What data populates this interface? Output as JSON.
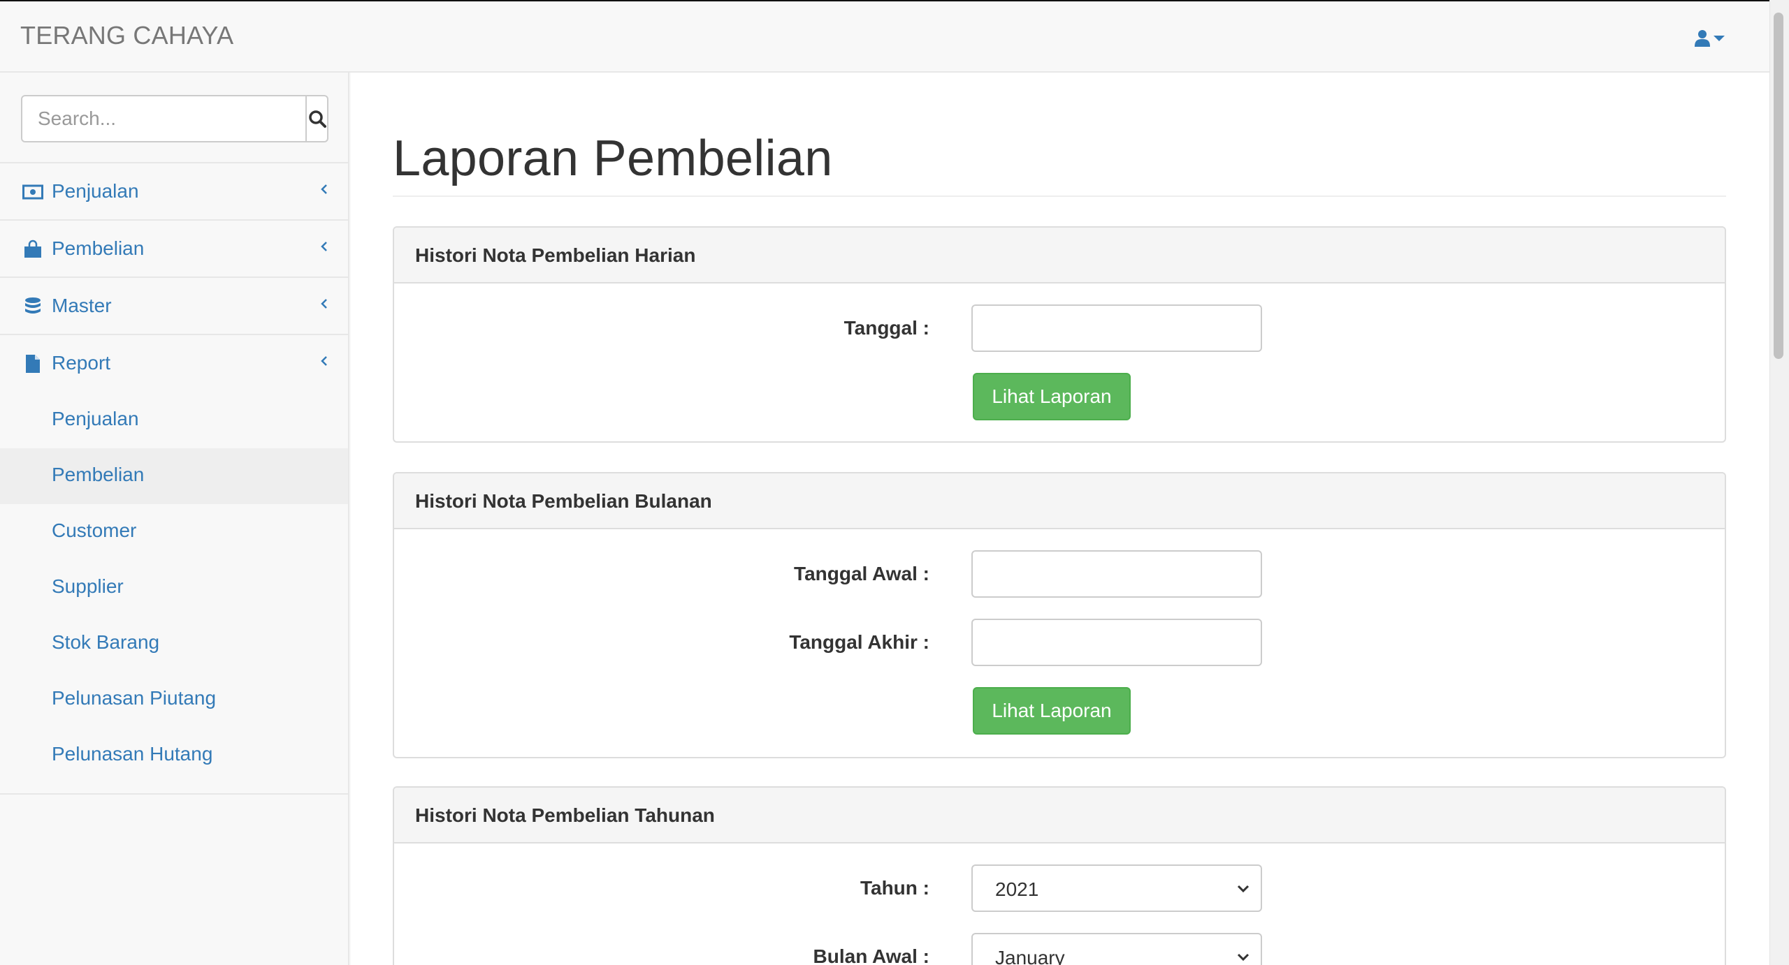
{
  "app": {
    "brand": "TERANG CAHAYA"
  },
  "search": {
    "placeholder": "Search..."
  },
  "sidebar": {
    "items": [
      {
        "label": "Penjualan",
        "icon": "money-icon"
      },
      {
        "label": "Pembelian",
        "icon": "shopping-bag-icon"
      },
      {
        "label": "Master",
        "icon": "database-icon"
      },
      {
        "label": "Report",
        "icon": "file-icon"
      }
    ],
    "report_submenu": [
      "Penjualan",
      "Pembelian",
      "Customer",
      "Supplier",
      "Stok Barang",
      "Pelunasan Piutang",
      "Pelunasan Hutang"
    ],
    "active_submenu": "Pembelian"
  },
  "main": {
    "title": "Laporan Pembelian",
    "panels": {
      "daily": {
        "heading": "Histori Nota Pembelian Harian",
        "date_label": "Tanggal :",
        "date_value": "",
        "button": "Lihat Laporan"
      },
      "monthly": {
        "heading": "Histori Nota Pembelian Bulanan",
        "start_label": "Tanggal Awal :",
        "start_value": "",
        "end_label": "Tanggal Akhir :",
        "end_value": "",
        "button": "Lihat Laporan"
      },
      "yearly": {
        "heading": "Histori Nota Pembelian Tahunan",
        "year_label": "Tahun :",
        "year_value": "2021",
        "start_month_label": "Bulan Awal :",
        "start_month_value": "January"
      }
    }
  },
  "colors": {
    "link": "#337ab7",
    "success": "#5cb85c",
    "active_bg": "#eeeeee"
  }
}
